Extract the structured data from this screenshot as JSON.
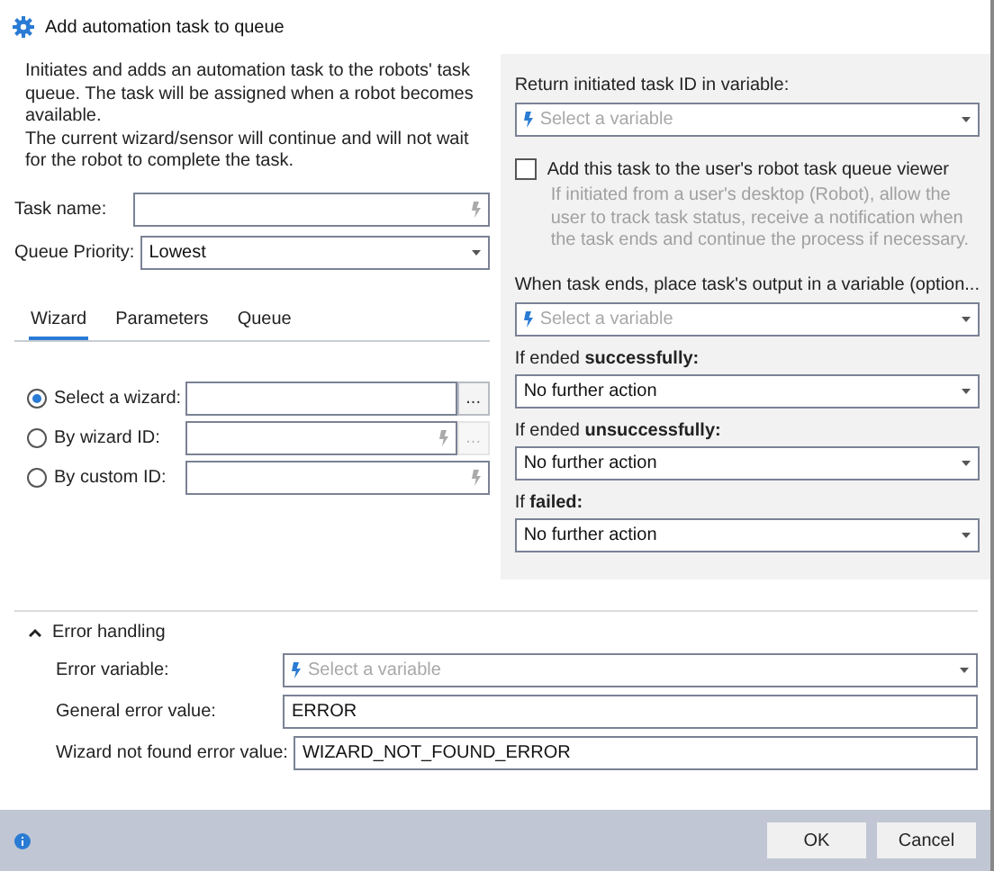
{
  "window": {
    "title": "Add automation task to queue"
  },
  "description": [
    "Initiates and adds an automation task to the robots' task queue. The task will be assigned when a robot becomes available.",
    "The current wizard/sensor will continue and will not wait for the robot to complete the task."
  ],
  "fields": [
    {
      "label": "Task name:",
      "kind": "text"
    },
    {
      "label": "Queue Priority:",
      "kind": "dropdown",
      "value": "Lowest"
    }
  ],
  "tabs": [
    {
      "label": "Wizard",
      "selected": true
    },
    {
      "label": "Parameters",
      "selected": false
    },
    {
      "label": "Queue",
      "selected": false
    }
  ],
  "wizard_options": [
    {
      "label": "Select a wizard:",
      "selected": true,
      "kind": "picker",
      "browse": {
        "label": "...",
        "disabled": false
      }
    },
    {
      "label": "By wizard ID:",
      "selected": false,
      "kind": "id",
      "browse": {
        "label": "...",
        "disabled": true
      }
    },
    {
      "label": "By custom ID:",
      "selected": false,
      "kind": "custom"
    }
  ],
  "return_variable": {
    "label": "Return initiated task ID in variable:",
    "placeholder": "Select a variable"
  },
  "queue_viewer": {
    "label": "Add this task to the user's robot task queue viewer",
    "checked": false,
    "description": "If initiated from a user's desktop (Robot), allow the user to track task status, receive a notification when the task ends and continue the process if necessary."
  },
  "output_variable": {
    "label": "When task ends, place task's output in a variable (option...",
    "placeholder": "Select a variable"
  },
  "outcomes": [
    {
      "label": "If ended **successfully:**",
      "value": "No further action"
    },
    {
      "label": "If ended **unsuccessfully:**",
      "value": "No further action"
    },
    {
      "label": "If **failed:**",
      "value": "No further action"
    }
  ],
  "error_handling": {
    "title": "Error handling",
    "expanded": true,
    "fields": [
      {
        "label": "Error variable:",
        "kind": "variable",
        "placeholder": "Select a variable"
      },
      {
        "label": "General error value:",
        "kind": "text",
        "value": "ERROR"
      },
      {
        "label": "Wizard not found error value:",
        "kind": "text",
        "value": "WIZARD_NOT_FOUND_ERROR"
      }
    ]
  },
  "buttons": [
    "OK",
    "Cancel"
  ]
}
